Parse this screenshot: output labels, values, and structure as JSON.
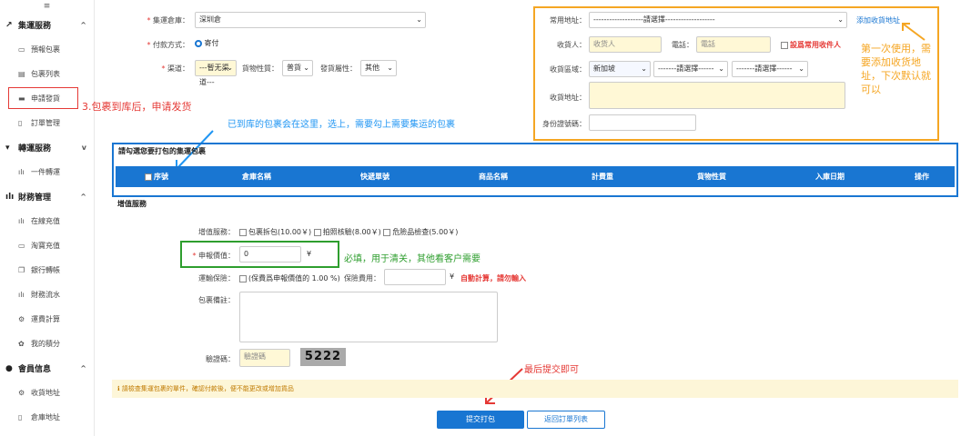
{
  "sidebar": {
    "menu_icon": "hamburger-icon",
    "groups": [
      {
        "label": "集運服務",
        "items": [
          {
            "label": "預報包裹"
          },
          {
            "label": "包裹列表"
          },
          {
            "label": "申請發貨"
          },
          {
            "label": "訂單管理"
          }
        ]
      },
      {
        "label": "轉運服務",
        "items": [
          {
            "label": "一件轉運"
          }
        ]
      },
      {
        "label": "財務管理",
        "items": [
          {
            "label": "在線充值"
          },
          {
            "label": "淘寶充值"
          },
          {
            "label": "銀行轉帳"
          },
          {
            "label": "財務流水"
          },
          {
            "label": "運費計算"
          },
          {
            "label": "我的積分"
          }
        ]
      },
      {
        "label": "會員信息",
        "items": [
          {
            "label": "收貨地址"
          },
          {
            "label": "倉庫地址"
          }
        ]
      }
    ]
  },
  "form": {
    "warehouse_label": "集運倉庫：",
    "warehouse_value": "深圳倉",
    "payment_label": "付款方式：",
    "payment_value": "寄付",
    "channel_label": "渠道：",
    "channel_value": "---暫无渠道---",
    "goods_nature_label": "貨物性質：",
    "goods_nature_value": "普貨",
    "ship_attr_label": "發貨屬性：",
    "ship_attr_value": "其他"
  },
  "address": {
    "common_label": "常用地址：",
    "common_value": "-------------------請選擇-------------------",
    "add_link": "添加收貨地址",
    "receiver_label": "收貨人：",
    "receiver_placeholder": "收货人",
    "phone_label": "電話：",
    "phone_placeholder": "電話",
    "set_common_label": "設爲常用收件人",
    "region_label": "收貨區域：",
    "region_1": "新加坡",
    "region_2": "-------請選擇------",
    "region_3": "-------請選擇------",
    "address_label": "收貨地址：",
    "id_label": "身份證號碼："
  },
  "packages": {
    "title": "請勾選您要打包的集運包裹",
    "columns": [
      "序號",
      "倉庫名稱",
      "快遞單號",
      "商品名稱",
      "計費重",
      "貨物性質",
      "入庫日期",
      "操作"
    ]
  },
  "value_added": {
    "section_title": "增值服務",
    "services_label": "增值服務：",
    "options": [
      "包裹拆包(10.00￥)",
      "拍照核驗(8.00￥)",
      "危險品檢查(5.00￥)"
    ],
    "declared_label": "申報價值：",
    "declared_value": "0",
    "currency": "¥",
    "insurance_label": "運輸保險：",
    "insurance_text": "(保費爲申報價值的 1.00 %)",
    "insurance_fee_label": "保險費用：",
    "auto_calc": "自動計算，請勿輸入",
    "remark_label": "包裹備註：",
    "captcha_label": "驗證碼：",
    "captcha_placeholder": "驗證碼",
    "captcha_image": "5222"
  },
  "notice": "請檢查集運包裹的單件，確認付款後，便不能更改或增加貨品",
  "buttons": {
    "submit": "提交打包",
    "back": "返回訂單列表"
  },
  "annotations": {
    "step3": "3.包裹到库后，申请发货",
    "arrived": "已到库的包裹会在这里，选上，需要勾上需要集运的包裹",
    "first_use": "第一次使用，需要添加收货地址，下次默认就可以",
    "required": "必填，用于清关，其他看客户需要",
    "submit_hint": "最后提交即可"
  },
  "colors": {
    "accent": "#1976d2",
    "annot_red": "#e53935",
    "annot_orange": "#f5a623",
    "annot_green": "#2e9e2e",
    "annot_blue": "#2196f3"
  }
}
